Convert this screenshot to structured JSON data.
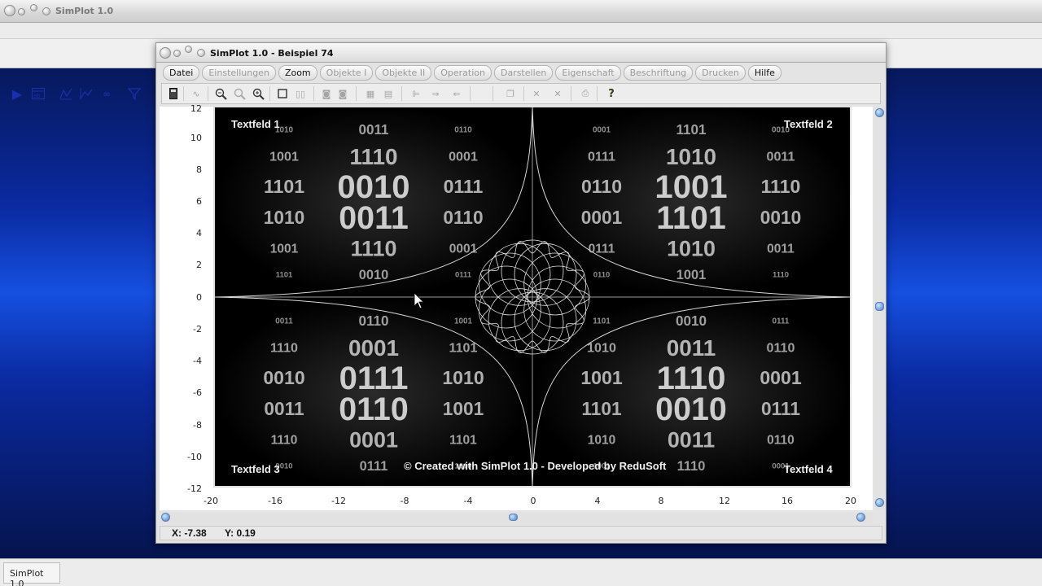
{
  "app": {
    "title": "SimPlot 1.0",
    "status": "SimPlot 1.0"
  },
  "outer_toolbar": {
    "icons": [
      "play-icon",
      "table-icon",
      "graph-icon",
      "polar-graph-icon",
      "oo-icon",
      "funnel-icon"
    ]
  },
  "window": {
    "title": "SimPlot 1.0 - Beispiel 74"
  },
  "menu": [
    {
      "label": "Datei",
      "enabled": true
    },
    {
      "label": "Einstellungen",
      "enabled": false
    },
    {
      "label": "Zoom",
      "enabled": true
    },
    {
      "label": "Objekte I",
      "enabled": false
    },
    {
      "label": "Objekte II",
      "enabled": false
    },
    {
      "label": "Operation",
      "enabled": false
    },
    {
      "label": "Darstellen",
      "enabled": false
    },
    {
      "label": "Eigenschaft",
      "enabled": false
    },
    {
      "label": "Beschriftung",
      "enabled": false
    },
    {
      "label": "Drucken",
      "enabled": false
    },
    {
      "label": "Hilfe",
      "enabled": true
    }
  ],
  "toolbar": {
    "icons": [
      "calculator-icon",
      "curve-icon",
      "zoom-in-icon",
      "zoom-reset-icon",
      "zoom-out-icon",
      "square-icon",
      "double-square-icon",
      "circle-box-icon",
      "circle-box-2-icon",
      "grid-icon",
      "copy-grid-icon",
      "align-icon",
      "arrow-right-icon",
      "arrow-left-icon",
      "pages-icon",
      "cross-icon",
      "cross-2-icon",
      "printer-icon",
      "help-icon"
    ]
  },
  "plot": {
    "y_ticks": [
      "12",
      "10",
      "8",
      "6",
      "4",
      "2",
      "0",
      "-2",
      "-4",
      "-6",
      "-8",
      "-10",
      "-12"
    ],
    "x_ticks": [
      "-20",
      "-16",
      "-12",
      "-8",
      "-4",
      "0",
      "4",
      "8",
      "12",
      "16",
      "20"
    ],
    "xlim": [
      -20,
      20
    ],
    "ylim": [
      -12,
      12
    ],
    "textfields": [
      "Textfeld 1",
      "Textfeld 2",
      "Textfeld 3",
      "Textfeld 4"
    ],
    "copyright": "© Created with SimPlot 1.0 - Developed by ReduSoft",
    "binary_rows": [
      "1010",
      "0011",
      "0110",
      "1001",
      "1110",
      "0001",
      "1101",
      "0010",
      "0111"
    ],
    "colors": {
      "background": "#000000",
      "curve": "#d8d8d8",
      "text": "#f0f0f0"
    }
  },
  "coords": {
    "x": "X: -7.38",
    "y": "Y: 0.19"
  }
}
